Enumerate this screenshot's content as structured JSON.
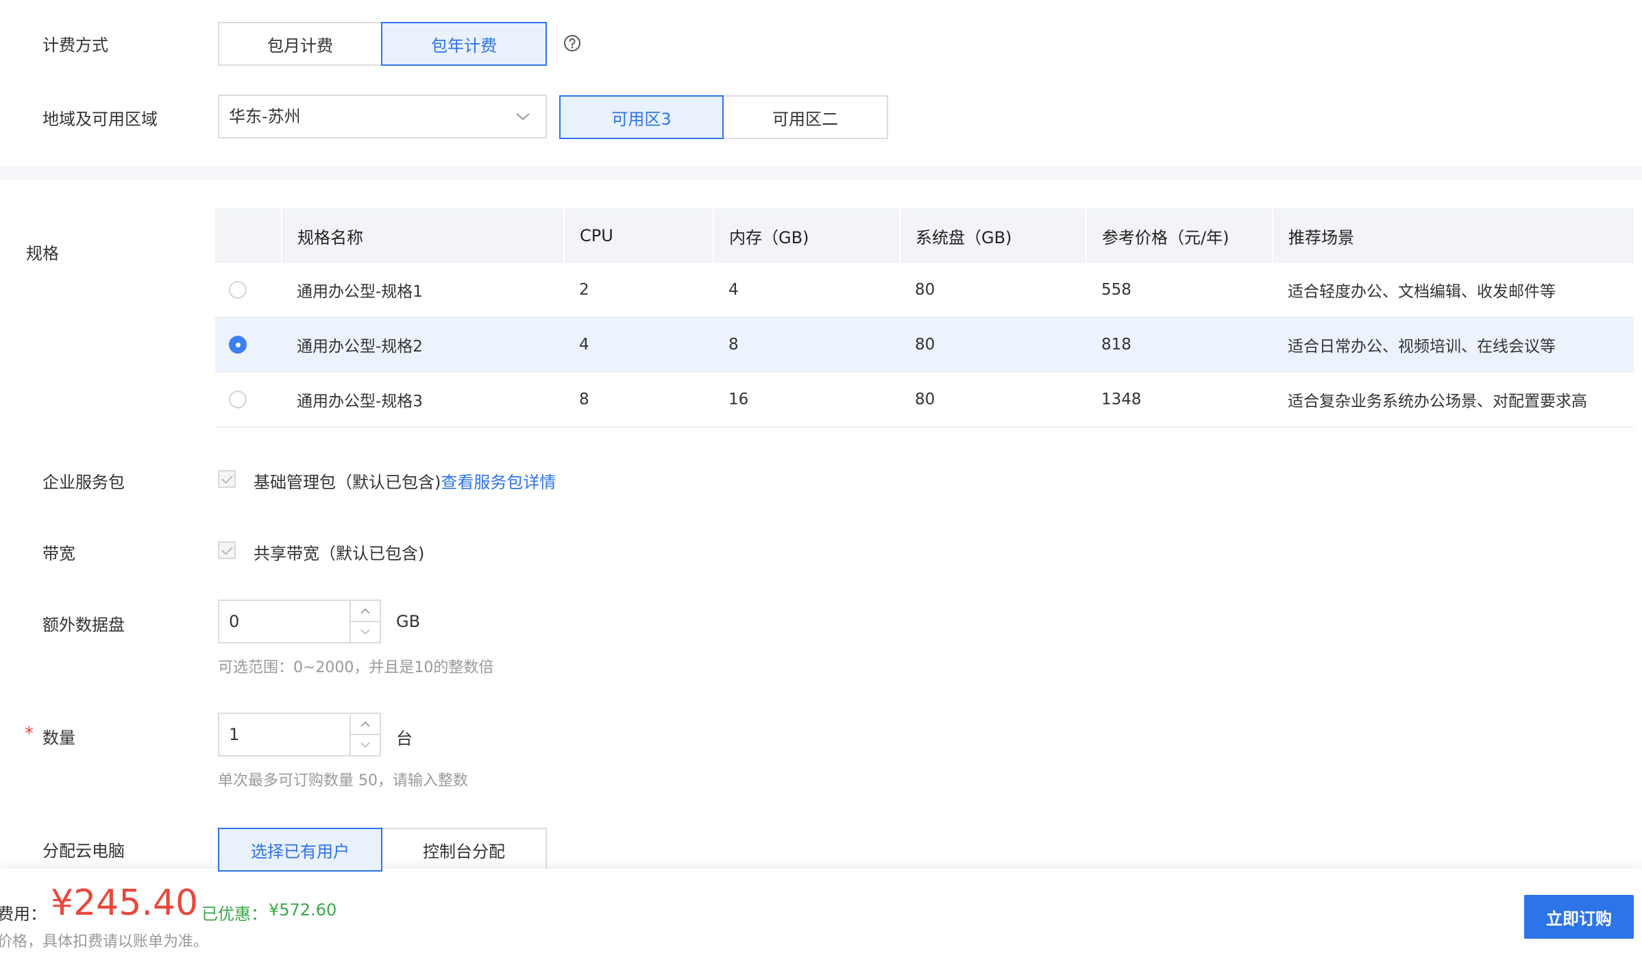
{
  "billing": {
    "label": "计费方式",
    "options": [
      "包月计费",
      "包年计费"
    ],
    "selected_index": 1
  },
  "region": {
    "label": "地域及可用区域",
    "selected": "华东-苏州",
    "zones": [
      "可用区3",
      "可用区二"
    ],
    "selected_zone_index": 0
  },
  "spec": {
    "label": "规格",
    "columns": [
      "",
      "规格名称",
      "CPU",
      "内存（GB)",
      "系统盘（GB)",
      "参考价格（元/年)",
      "推荐场景"
    ],
    "rows": [
      {
        "name": "通用办公型-规格1",
        "cpu": "2",
        "mem": "4",
        "disk": "80",
        "price": "558",
        "scene": "适合轻度办公、文档编辑、收发邮件等"
      },
      {
        "name": "通用办公型-规格2",
        "cpu": "4",
        "mem": "8",
        "disk": "80",
        "price": "818",
        "scene": "适合日常办公、视频培训、在线会议等"
      },
      {
        "name": "通用办公型-规格3",
        "cpu": "8",
        "mem": "16",
        "disk": "80",
        "price": "1348",
        "scene": "适合复杂业务系统办公场景、对配置要求高"
      }
    ],
    "selected_index": 1
  },
  "service_pack": {
    "label": "企业服务包",
    "text": "基础管理包（默认已包含)",
    "link": "查看服务包详情"
  },
  "bandwidth": {
    "label": "带宽",
    "text": "共享带宽（默认已包含)"
  },
  "data_disk": {
    "label": "额外数据盘",
    "value": "0",
    "unit": "GB",
    "hint": "可选范围：0~2000，并且是10的整数倍"
  },
  "quantity": {
    "required_mark": "*",
    "label": "数量",
    "value": "1",
    "unit": "台",
    "hint": "单次最多可订购数量 50，请输入整数"
  },
  "assign": {
    "label": "分配云电脑",
    "options": [
      "选择已有用户",
      "控制台分配"
    ],
    "selected_index": 0
  },
  "footer": {
    "fee_label": "费用：",
    "price": "¥245.40",
    "discount_label": "已优惠：",
    "discount_value": "¥572.60",
    "note": "价格，具体扣费请以账单为准。",
    "buy_label": "立即订购"
  },
  "colors": {
    "accent": "#2d74e8",
    "price_red": "#e8483b",
    "discount_green": "#3aa64a"
  }
}
